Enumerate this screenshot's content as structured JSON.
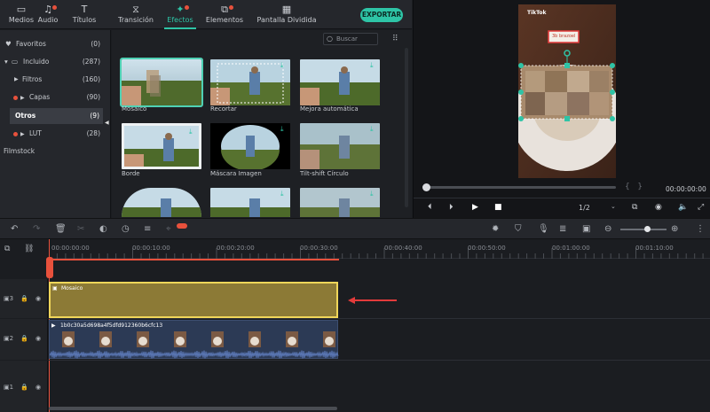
{
  "tabs": [
    {
      "label": "Medios",
      "icon": "folder-icon",
      "dot": false
    },
    {
      "label": "Audio",
      "icon": "music-note-icon",
      "dot": true
    },
    {
      "label": "Títulos",
      "icon": "text-icon",
      "dot": false
    },
    {
      "label": "Transición",
      "icon": "transition-icon",
      "dot": false
    },
    {
      "label": "Efectos",
      "icon": "effects-icon",
      "dot": true,
      "active": true
    },
    {
      "label": "Elementos",
      "icon": "elements-icon",
      "dot": true
    },
    {
      "label": "Pantalla Dividida",
      "icon": "split-screen-icon",
      "dot": false
    }
  ],
  "export_label": "EXPORTAR",
  "search_placeholder": "Buscar",
  "tree": [
    {
      "label": "Favoritos",
      "count": "(0)"
    },
    {
      "label": "Incluido",
      "count": "(287)"
    },
    {
      "label": "Filtros",
      "count": "(160)"
    },
    {
      "label": "Capas",
      "count": "(90)"
    },
    {
      "label": "Otros",
      "count": "(9)"
    },
    {
      "label": "LUT",
      "count": "(28)"
    },
    {
      "label": "Filmstock",
      "count": ""
    }
  ],
  "effects": [
    {
      "label": "Mosaico"
    },
    {
      "label": "Recortar"
    },
    {
      "label": "Mejora automática"
    },
    {
      "label": "Borde"
    },
    {
      "label": "Máscara Imagen"
    },
    {
      "label": "Tilt-shift Círculo"
    },
    {
      "label": ""
    },
    {
      "label": ""
    },
    {
      "label": ""
    }
  ],
  "preview": {
    "tiktok": "TikTok",
    "caption": "3b brazoel",
    "time": "00:00:00:00",
    "ratio": "1/2",
    "progress": 0.0
  },
  "timeline": {
    "ticks": [
      "00:00:00:00",
      "00:00:10:00",
      "00:00:20:00",
      "00:00:30:00",
      "00:00:40:00",
      "00:00:50:00",
      "00:01:00:00",
      "00:01:10:00"
    ],
    "mosaic_clip": "Mosaico",
    "video_clip": "1b0c30a5d698a4f5dfd912360b6cfc13",
    "track_labels": [
      "3",
      "2",
      "1"
    ]
  },
  "colors": {
    "accent": "#2ec4a6",
    "clip_yellow": "#8c7a36",
    "clip_border": "#f0d65a",
    "arrow": "#e33b3b",
    "playhead": "#e8513c"
  }
}
